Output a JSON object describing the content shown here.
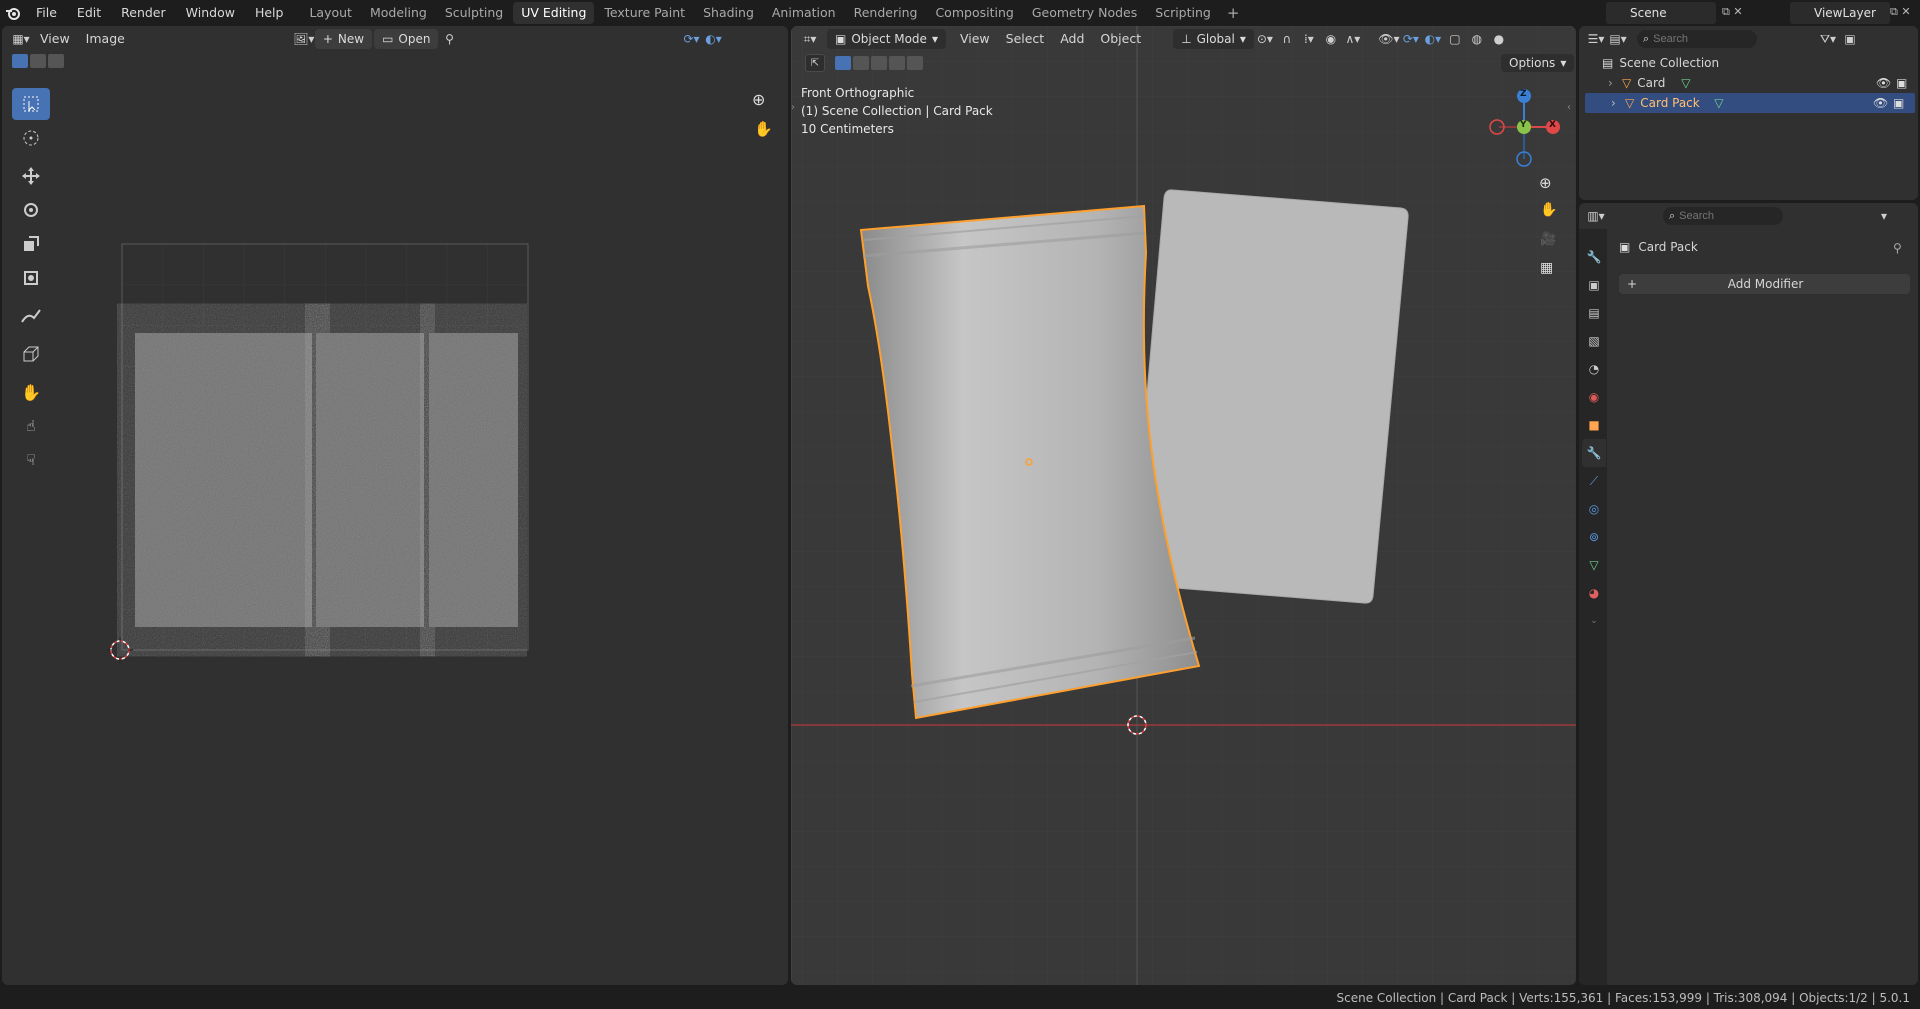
{
  "menu": [
    "File",
    "Edit",
    "Render",
    "Window",
    "Help"
  ],
  "workspaces": [
    {
      "label": "Layout",
      "active": false
    },
    {
      "label": "Modeling",
      "active": false
    },
    {
      "label": "Sculpting",
      "active": false
    },
    {
      "label": "UV Editing",
      "active": true
    },
    {
      "label": "Texture Paint",
      "active": false
    },
    {
      "label": "Shading",
      "active": false
    },
    {
      "label": "Animation",
      "active": false
    },
    {
      "label": "Rendering",
      "active": false
    },
    {
      "label": "Compositing",
      "active": false
    },
    {
      "label": "Geometry Nodes",
      "active": false
    },
    {
      "label": "Scripting",
      "active": false
    }
  ],
  "scene": "Scene",
  "view_layer": "ViewLayer",
  "uv_editor": {
    "view": "View",
    "image": "Image",
    "new": "New",
    "open": "Open"
  },
  "viewport": {
    "mode": "Object Mode",
    "view": "View",
    "select": "Select",
    "add": "Add",
    "object": "Object",
    "orientation": "Global",
    "options": "Options",
    "overlay_line1": "Front Orthographic",
    "overlay_line2": "(1) Scene Collection | Card Pack",
    "overlay_line3": "10 Centimeters",
    "gizmo": {
      "z": "Z",
      "y": "Y",
      "x": "X"
    }
  },
  "outliner": {
    "search_placeholder": "Search",
    "collection": "Scene Collection",
    "items": [
      {
        "name": "Card",
        "selected": false
      },
      {
        "name": "Card Pack",
        "selected": true
      }
    ]
  },
  "properties": {
    "search_placeholder": "Search",
    "object_name": "Card Pack",
    "add_modifier": "Add Modifier"
  },
  "status": "Scene Collection | Card Pack | Verts:155,361 | Faces:153,999 | Tris:308,094 | Objects:1/2 | 5.0.1",
  "colors": {
    "accent": "#4772b3",
    "selection": "#ff9f2e",
    "bg": "#303030"
  }
}
